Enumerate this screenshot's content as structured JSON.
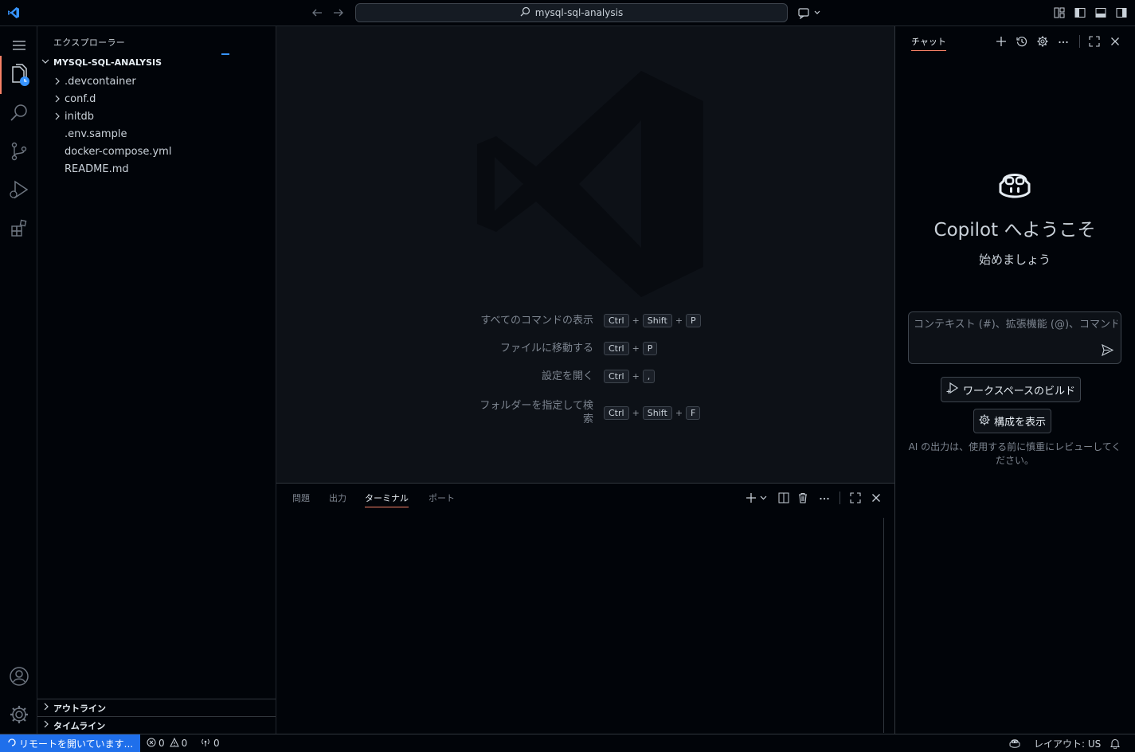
{
  "titlebar": {
    "search_text": "mysql-sql-analysis",
    "accent": "#3794ff"
  },
  "activitybar": {
    "items": [
      "explorer-icon",
      "search-icon",
      "source-control-icon",
      "run-debug-icon",
      "extensions-icon"
    ],
    "bottom": [
      "account-icon",
      "settings-icon"
    ],
    "active_indicator": "#f78166"
  },
  "sidebar": {
    "title": "エクスプローラー",
    "root": "MYSQL-SQL-ANALYSIS",
    "files": [
      {
        "name": ".devcontainer",
        "folder": true
      },
      {
        "name": "conf.d",
        "folder": true
      },
      {
        "name": "initdb",
        "folder": true
      },
      {
        "name": ".env.sample",
        "folder": false
      },
      {
        "name": "docker-compose.yml",
        "folder": false
      },
      {
        "name": "README.md",
        "folder": false
      }
    ],
    "outline": "アウトライン",
    "timeline": "タイムライン"
  },
  "editor": {
    "shortcuts": [
      {
        "label": "すべてのコマンドの表示",
        "keys": [
          "Ctrl",
          "Shift",
          "P"
        ]
      },
      {
        "label": "ファイルに移動する",
        "keys": [
          "Ctrl",
          "P"
        ]
      },
      {
        "label": "設定を開く",
        "keys": [
          "Ctrl",
          ","
        ]
      },
      {
        "label_line1": "フォルダーを指定して検",
        "label_line2": "索",
        "keys": [
          "Ctrl",
          "Shift",
          "F"
        ]
      }
    ]
  },
  "panel": {
    "tabs": [
      "問題",
      "出力",
      "ターミナル",
      "ポート"
    ],
    "active_tab": "ターミナル"
  },
  "chat": {
    "tab": "チャット",
    "welcome_title": "Copilot へようこそ",
    "welcome_sub": "始めましょう",
    "input_placeholder": "コンテキスト (#)、拡張機能 (@)、コマンド",
    "build_btn": "ワークスペースのビルド",
    "config_btn": "構成を表示",
    "disclaimer_line1": "AI の出力は、使用する前に慎重にレビューしてく",
    "disclaimer_line2": "ださい。"
  },
  "statusbar": {
    "remote": "リモートを開いています...",
    "remote_bg": "#1f6feb",
    "errors": "0",
    "warnings": "0",
    "ports": "0",
    "layout": "レイアウト: US"
  }
}
